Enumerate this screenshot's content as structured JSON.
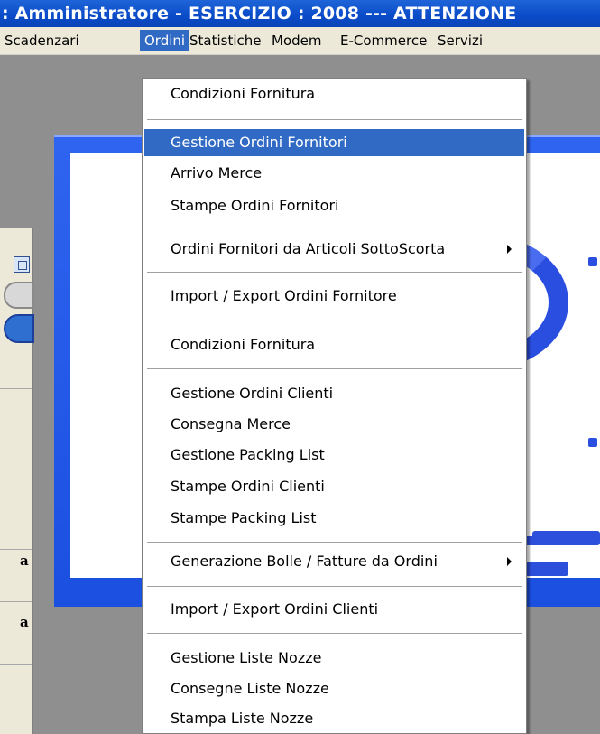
{
  "window": {
    "title": ": Amministratore - ESERCIZIO : 2008    --- ATTENZIONE"
  },
  "menubar": {
    "items": [
      "Scadenzari",
      "Ordini",
      "Statistiche",
      "Modem",
      "E-Commerce",
      "Servizi"
    ],
    "active": "Ordini"
  },
  "dropdown": {
    "items": [
      {
        "label": "Condizioni Fornitura"
      },
      {
        "label": "Gestione Ordini Fornitori",
        "highlighted": true
      },
      {
        "label": "Arrivo Merce"
      },
      {
        "label": "Stampe Ordini Fornitori"
      },
      {
        "label": "Ordini Fornitori da Articoli SottoScorta",
        "submenu": true
      },
      {
        "label": "Import / Export Ordini Fornitore"
      },
      {
        "label": "Condizioni Fornitura"
      },
      {
        "label": "Gestione Ordini Clienti"
      },
      {
        "label": "Consegna Merce"
      },
      {
        "label": "Gestione Packing List"
      },
      {
        "label": "Stampe Ordini Clienti"
      },
      {
        "label": "Stampe Packing List"
      },
      {
        "label": "Generazione Bolle / Fatture da Ordini",
        "submenu": true
      },
      {
        "label": "Import / Export Ordini Clienti"
      },
      {
        "label": "Gestione Liste Nozze"
      },
      {
        "label": "Consegne Liste Nozze"
      },
      {
        "label": "Stampa Liste Nozze"
      }
    ]
  },
  "side_window": {
    "row_labels": [
      "a",
      "a"
    ]
  },
  "colors": {
    "titlebar": "#0a4bc8",
    "menu_highlight": "#316ac5",
    "splash_blue": "#1b4fe0",
    "desktop": "#8f8f8f"
  }
}
